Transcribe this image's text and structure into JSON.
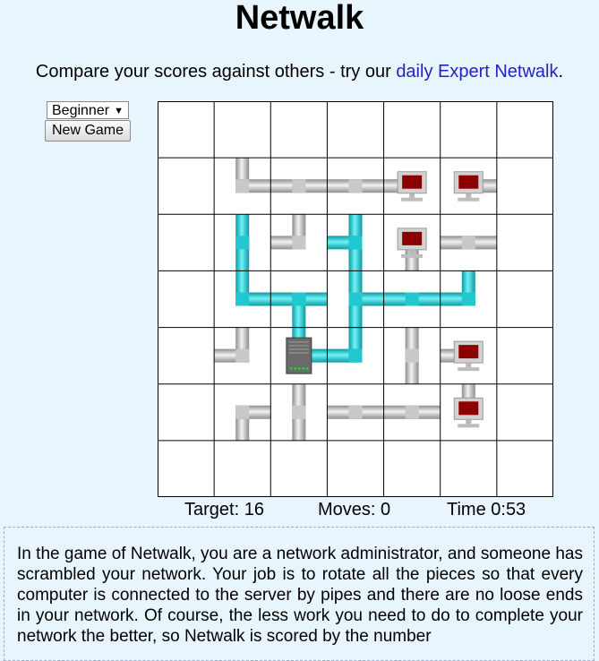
{
  "title": "Netwalk",
  "subtitle": {
    "prefix": "Compare your scores against others - try our ",
    "link": "daily Expert Netwalk",
    "suffix": "."
  },
  "controls": {
    "level_selected": "Beginner",
    "new_game_label": "New Game"
  },
  "board": {
    "rows": 7,
    "cols": 7,
    "colors": {
      "background": "#ffffff",
      "grid": "#000000",
      "pipe_inactive": "#c8c8c8",
      "pipe_active": "#22c8d0",
      "monitor_screen": "#8b0000",
      "server": "#6a6a6a"
    },
    "tiles": [
      {
        "row": 1,
        "col": 1,
        "type": "pipe",
        "dirs": [
          "N",
          "E"
        ],
        "active": false
      },
      {
        "row": 1,
        "col": 2,
        "type": "pipe",
        "dirs": [
          "W",
          "E"
        ],
        "active": false
      },
      {
        "row": 1,
        "col": 3,
        "type": "pipe",
        "dirs": [
          "W",
          "E"
        ],
        "active": false
      },
      {
        "row": 1,
        "col": 4,
        "type": "computer",
        "dirs": [
          "W"
        ],
        "active": false
      },
      {
        "row": 1,
        "col": 5,
        "type": "computer",
        "dirs": [
          "E"
        ],
        "active": false
      },
      {
        "row": 2,
        "col": 1,
        "type": "pipe",
        "dirs": [
          "N",
          "S"
        ],
        "active": true
      },
      {
        "row": 2,
        "col": 2,
        "type": "pipe",
        "dirs": [
          "N",
          "W"
        ],
        "active": false
      },
      {
        "row": 2,
        "col": 3,
        "type": "pipe",
        "dirs": [
          "N",
          "S",
          "W"
        ],
        "active": true
      },
      {
        "row": 2,
        "col": 4,
        "type": "computer",
        "dirs": [
          "S"
        ],
        "active": false
      },
      {
        "row": 2,
        "col": 5,
        "type": "pipe",
        "dirs": [
          "W",
          "E"
        ],
        "active": false
      },
      {
        "row": 3,
        "col": 1,
        "type": "pipe",
        "dirs": [
          "N",
          "E"
        ],
        "active": true
      },
      {
        "row": 3,
        "col": 2,
        "type": "pipe",
        "dirs": [
          "W",
          "E",
          "S"
        ],
        "active": true
      },
      {
        "row": 3,
        "col": 3,
        "type": "pipe",
        "dirs": [
          "N",
          "E",
          "S"
        ],
        "active": true
      },
      {
        "row": 3,
        "col": 4,
        "type": "pipe",
        "dirs": [
          "W",
          "E"
        ],
        "active": true
      },
      {
        "row": 3,
        "col": 5,
        "type": "pipe",
        "dirs": [
          "N",
          "W"
        ],
        "active": true
      },
      {
        "row": 4,
        "col": 1,
        "type": "pipe",
        "dirs": [
          "N",
          "W"
        ],
        "active": false
      },
      {
        "row": 4,
        "col": 2,
        "type": "server",
        "dirs": [
          "N",
          "E"
        ],
        "active": true
      },
      {
        "row": 4,
        "col": 3,
        "type": "pipe",
        "dirs": [
          "N",
          "W"
        ],
        "active": true
      },
      {
        "row": 4,
        "col": 4,
        "type": "pipe",
        "dirs": [
          "N",
          "S"
        ],
        "active": false
      },
      {
        "row": 4,
        "col": 5,
        "type": "computer",
        "dirs": [
          "W"
        ],
        "active": false
      },
      {
        "row": 5,
        "col": 1,
        "type": "pipe",
        "dirs": [
          "S",
          "E"
        ],
        "active": false
      },
      {
        "row": 5,
        "col": 2,
        "type": "pipe",
        "dirs": [
          "N",
          "S"
        ],
        "active": false
      },
      {
        "row": 5,
        "col": 3,
        "type": "pipe",
        "dirs": [
          "W",
          "E"
        ],
        "active": false
      },
      {
        "row": 5,
        "col": 4,
        "type": "pipe",
        "dirs": [
          "W",
          "E"
        ],
        "active": false
      },
      {
        "row": 5,
        "col": 5,
        "type": "computer",
        "dirs": [
          "N"
        ],
        "active": false
      }
    ]
  },
  "status": {
    "target": "Target: 16",
    "moves": "Moves: 0",
    "time": "Time 0:53"
  },
  "info": {
    "text": "In the game of Netwalk, you are a network administrator, and someone has scrambled your network. Your job is to rotate all the pieces so that every computer is connected to the server by pipes and there are no loose ends in your network. Of course, the less work you need to do to complete your network the better, so Netwalk is scored by the number"
  }
}
